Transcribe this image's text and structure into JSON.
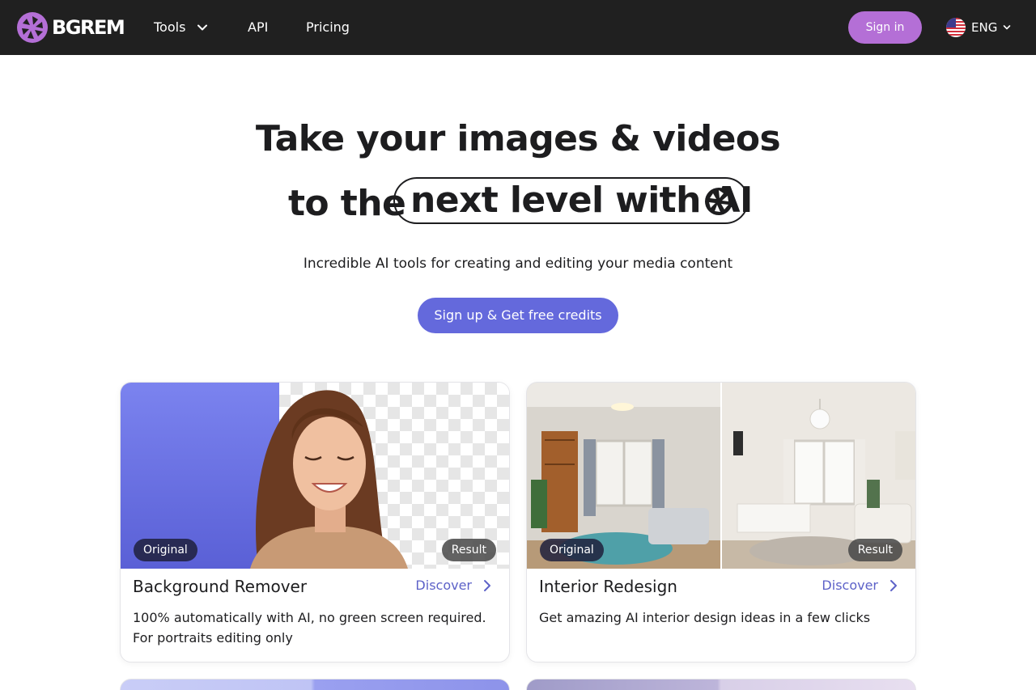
{
  "header": {
    "logo_text": "BGREM",
    "nav": {
      "tools": "Tools",
      "api": "API",
      "pricing": "Pricing"
    },
    "signin_label": "Sign in",
    "language": "ENG"
  },
  "hero": {
    "line1": "Take your images & videos",
    "line2_lead": "to the",
    "line2_highlight": "next level with AI",
    "subtitle": "Incredible AI tools for creating and editing your media content",
    "cta_label": "Sign up & Get free credits"
  },
  "cards": [
    {
      "title": "Background Remover",
      "link_label": "Discover",
      "description": "100% automatically with AI, no green screen required. For portraits editing only",
      "tag_original": "Original",
      "tag_result": "Result"
    },
    {
      "title": "Interior Redesign",
      "link_label": "Discover",
      "description": "Get amazing AI interior design ideas in a few clicks",
      "tag_original": "Original",
      "tag_result": "Result"
    }
  ],
  "colors": {
    "header_bg": "#202020",
    "brand_purple": "#b46fd6",
    "cta_blue": "#6469dc",
    "link_blue": "#5d62c8"
  },
  "icons": [
    "aperture-logo-icon",
    "chevron-down-icon",
    "us-flag-icon",
    "aperture-icon",
    "chevron-right-icon"
  ]
}
